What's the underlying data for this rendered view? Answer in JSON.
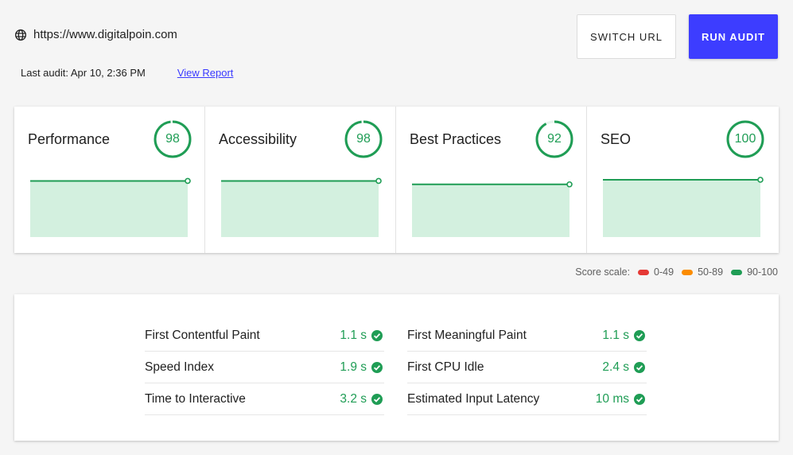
{
  "header": {
    "url": "https://www.digitalpoin.com",
    "last_audit_label": "Last audit: Apr 10, 2:36 PM",
    "view_report_label": "View Report",
    "switch_url_label": "SWITCH URL",
    "run_audit_label": "RUN AUDIT"
  },
  "scores": [
    {
      "title": "Performance",
      "score": "98",
      "value": 98
    },
    {
      "title": "Accessibility",
      "score": "98",
      "value": 98
    },
    {
      "title": "Best Practices",
      "score": "92",
      "value": 92
    },
    {
      "title": "SEO",
      "score": "100",
      "value": 100
    }
  ],
  "scale": {
    "label": "Score scale:",
    "ranges": [
      {
        "label": "0-49",
        "color": "#e53935"
      },
      {
        "label": "50-89",
        "color": "#fb8c00"
      },
      {
        "label": "90-100",
        "color": "#1f9d55"
      }
    ]
  },
  "metrics": {
    "left": [
      {
        "name": "First Contentful Paint",
        "value": "1.1 s"
      },
      {
        "name": "Speed Index",
        "value": "1.9 s"
      },
      {
        "name": "Time to Interactive",
        "value": "3.2 s"
      }
    ],
    "right": [
      {
        "name": "First Meaningful Paint",
        "value": "1.1 s"
      },
      {
        "name": "First CPU Idle",
        "value": "2.4 s"
      },
      {
        "name": "Estimated Input Latency",
        "value": "10 ms"
      }
    ]
  },
  "colors": {
    "good": "#1f9d55",
    "accent": "#3d3dff"
  }
}
